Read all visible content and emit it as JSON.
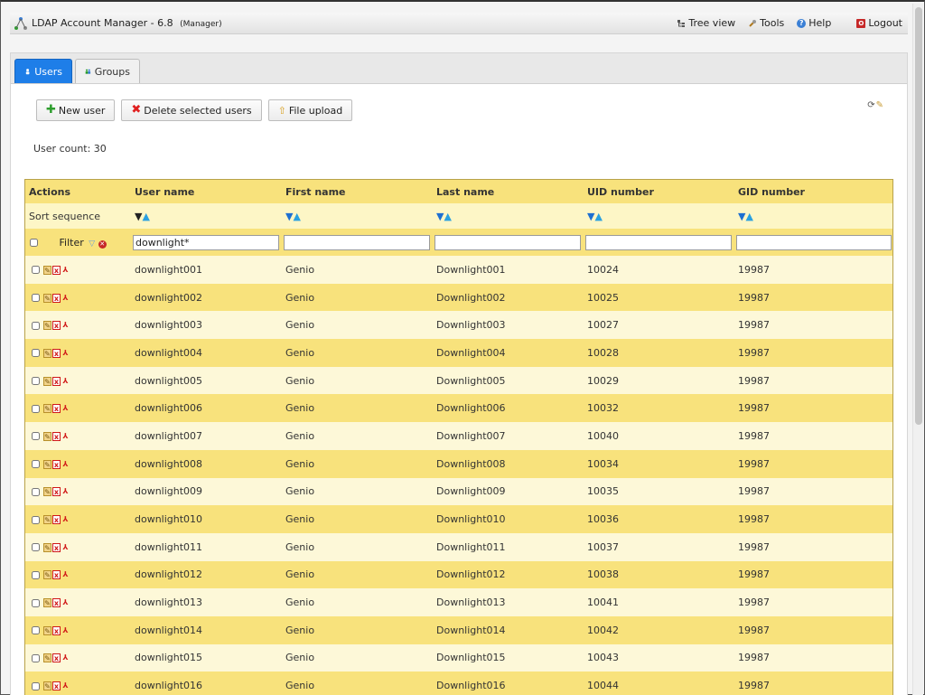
{
  "header": {
    "title": "LDAP Account Manager - 6.8",
    "mode": "(Manager)",
    "menu": [
      {
        "label": "Tree view",
        "icon": "tree-view-icon"
      },
      {
        "label": "Tools",
        "icon": "tools-icon"
      },
      {
        "label": "Help",
        "icon": "help-icon"
      },
      {
        "label": "Logout",
        "icon": "logout-icon"
      }
    ]
  },
  "tabs": [
    {
      "label": "Users",
      "active": true
    },
    {
      "label": "Groups",
      "active": false
    }
  ],
  "toolbar": {
    "new_user": "New user",
    "delete_selected": "Delete selected users",
    "file_upload": "File upload"
  },
  "user_count": "User count: 30",
  "table": {
    "columns": [
      "Actions",
      "User name",
      "First name",
      "Last name",
      "UID number",
      "GID number"
    ],
    "sort_label": "Sort sequence",
    "filter_label": "Filter",
    "filter_values": [
      "downlight*",
      "",
      "",
      "",
      ""
    ],
    "rows": [
      [
        "downlight001",
        "Genio",
        "Downlight001",
        "10024",
        "19987"
      ],
      [
        "downlight002",
        "Genio",
        "Downlight002",
        "10025",
        "19987"
      ],
      [
        "downlight003",
        "Genio",
        "Downlight003",
        "10027",
        "19987"
      ],
      [
        "downlight004",
        "Genio",
        "Downlight004",
        "10028",
        "19987"
      ],
      [
        "downlight005",
        "Genio",
        "Downlight005",
        "10029",
        "19987"
      ],
      [
        "downlight006",
        "Genio",
        "Downlight006",
        "10032",
        "19987"
      ],
      [
        "downlight007",
        "Genio",
        "Downlight007",
        "10040",
        "19987"
      ],
      [
        "downlight008",
        "Genio",
        "Downlight008",
        "10034",
        "19987"
      ],
      [
        "downlight009",
        "Genio",
        "Downlight009",
        "10035",
        "19987"
      ],
      [
        "downlight010",
        "Genio",
        "Downlight010",
        "10036",
        "19987"
      ],
      [
        "downlight011",
        "Genio",
        "Downlight011",
        "10037",
        "19987"
      ],
      [
        "downlight012",
        "Genio",
        "Downlight012",
        "10038",
        "19987"
      ],
      [
        "downlight013",
        "Genio",
        "Downlight013",
        "10041",
        "19987"
      ],
      [
        "downlight014",
        "Genio",
        "Downlight014",
        "10042",
        "19987"
      ],
      [
        "downlight015",
        "Genio",
        "Downlight015",
        "10043",
        "19987"
      ],
      [
        "downlight016",
        "Genio",
        "Downlight016",
        "10044",
        "19987"
      ]
    ]
  }
}
